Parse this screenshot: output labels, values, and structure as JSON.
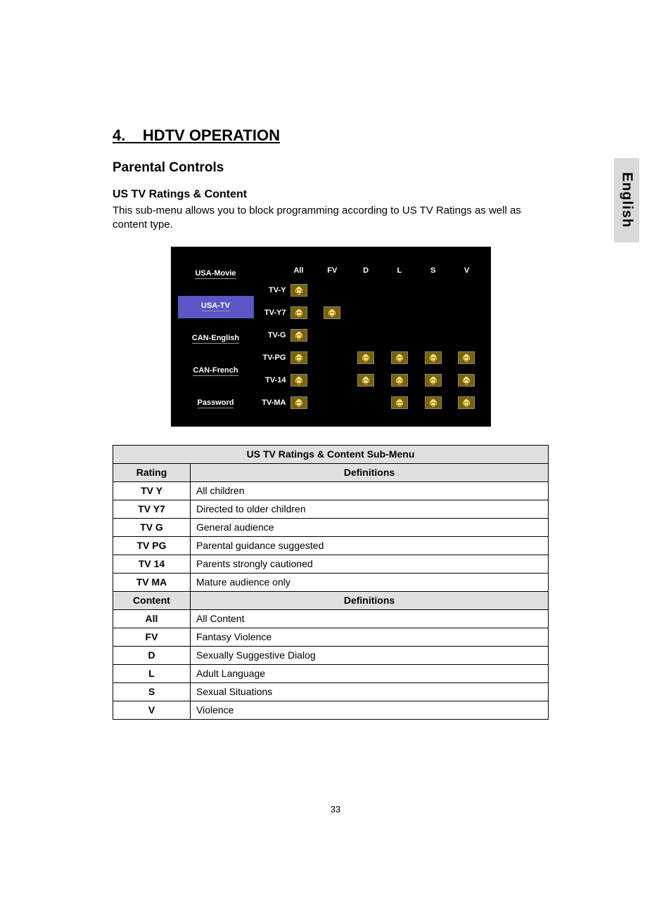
{
  "lang_tab": "English",
  "section_number": "4.",
  "section_title": "HDTV OPERATION",
  "subsection": "Parental Controls",
  "topic": "US TV Ratings & Content",
  "intro": "This sub-menu allows you to block programming according to US TV Ratings as well as content type.",
  "osd": {
    "sidebar": [
      "USA-Movie",
      "USA-TV",
      "CAN-English",
      "CAN-French",
      "Password"
    ],
    "selected_index": 1,
    "columns": [
      "All",
      "FV",
      "D",
      "L",
      "S",
      "V"
    ],
    "rows": [
      {
        "label": "TV-Y",
        "locks": [
          true,
          false,
          false,
          false,
          false,
          false
        ]
      },
      {
        "label": "TV-Y7",
        "locks": [
          true,
          true,
          false,
          false,
          false,
          false
        ]
      },
      {
        "label": "TV-G",
        "locks": [
          true,
          false,
          false,
          false,
          false,
          false
        ]
      },
      {
        "label": "TV-PG",
        "locks": [
          true,
          false,
          true,
          true,
          true,
          true
        ]
      },
      {
        "label": "TV-14",
        "locks": [
          true,
          false,
          true,
          true,
          true,
          true
        ]
      },
      {
        "label": "TV-MA",
        "locks": [
          true,
          false,
          false,
          true,
          true,
          true
        ]
      }
    ]
  },
  "def_table": {
    "title": "US TV Ratings & Content Sub-Menu",
    "rating_header": "Rating",
    "def_header": "Definitions",
    "content_header": "Content",
    "ratings": [
      {
        "code": "TV Y",
        "def": "All children"
      },
      {
        "code": "TV Y7",
        "def": "Directed to older children"
      },
      {
        "code": "TV G",
        "def": "General audience"
      },
      {
        "code": "TV PG",
        "def": "Parental guidance suggested"
      },
      {
        "code": "TV 14",
        "def": "Parents strongly cautioned"
      },
      {
        "code": "TV MA",
        "def": "Mature audience only"
      }
    ],
    "contents": [
      {
        "code": "All",
        "def": "All Content"
      },
      {
        "code": "FV",
        "def": "Fantasy Violence"
      },
      {
        "code": "D",
        "def": "Sexually Suggestive Dialog"
      },
      {
        "code": "L",
        "def": "Adult Language"
      },
      {
        "code": "S",
        "def": "Sexual Situations"
      },
      {
        "code": "V",
        "def": "Violence"
      }
    ]
  },
  "page_number": "33"
}
